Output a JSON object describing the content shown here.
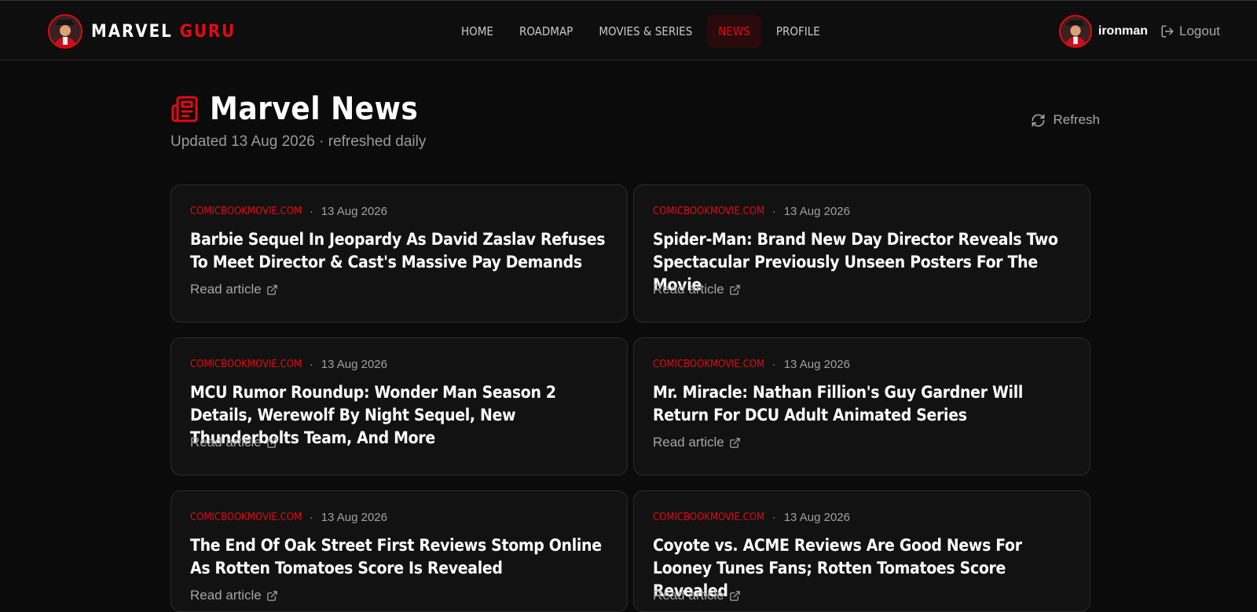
{
  "brand": {
    "name_part1": "MARVEL",
    "name_part2": "GURU"
  },
  "nav": [
    {
      "label": "HOME",
      "active": false
    },
    {
      "label": "ROADMAP",
      "active": false
    },
    {
      "label": "MOVIES & SERIES",
      "active": false
    },
    {
      "label": "NEWS",
      "active": true
    },
    {
      "label": "PROFILE",
      "active": false
    }
  ],
  "user": {
    "username": "ironman",
    "logout_label": "Logout"
  },
  "page": {
    "title": "Marvel News",
    "subtitle": "Updated 13 Aug 2026 · refreshed daily",
    "refresh_label": "Refresh"
  },
  "articles": [
    {
      "source": "COMICBOOKMOVIE.COM",
      "date": "13 Aug 2026",
      "headline": "Barbie Sequel In Jeopardy As David Zaslav Refuses To Meet Director & Cast's Massive Pay Demands",
      "link_label": "Read article"
    },
    {
      "source": "COMICBOOKMOVIE.COM",
      "date": "13 Aug 2026",
      "headline": "Spider-Man: Brand New Day Director Reveals Two Spectacular Previously Unseen Posters For The Movie",
      "link_label": "Read article"
    },
    {
      "source": "COMICBOOKMOVIE.COM",
      "date": "13 Aug 2026",
      "headline": "MCU Rumor Roundup: Wonder Man Season 2 Details, Werewolf By Night Sequel, New Thunderbolts Team, And More",
      "link_label": "Read article"
    },
    {
      "source": "COMICBOOKMOVIE.COM",
      "date": "13 Aug 2026",
      "headline": "Mr. Miracle: Nathan Fillion's Guy Gardner Will Return For DCU Adult Animated Series",
      "link_label": "Read article"
    },
    {
      "source": "COMICBOOKMOVIE.COM",
      "date": "13 Aug 2026",
      "headline": "The End Of Oak Street First Reviews Stomp Online As Rotten Tomatoes Score Is Revealed",
      "link_label": "Read article"
    },
    {
      "source": "COMICBOOKMOVIE.COM",
      "date": "13 Aug 2026",
      "headline": "Coyote vs. ACME Reviews Are Good News For Looney Tunes Fans; Rotten Tomatoes Score Revealed",
      "link_label": "Read article"
    }
  ],
  "colors": {
    "accent": "#e50914",
    "background": "#0b0b0b",
    "card": "#121212"
  },
  "icons": {
    "page": "newspaper-icon",
    "refresh": "refresh-icon",
    "logout": "logout-icon",
    "external": "external-link-icon"
  }
}
